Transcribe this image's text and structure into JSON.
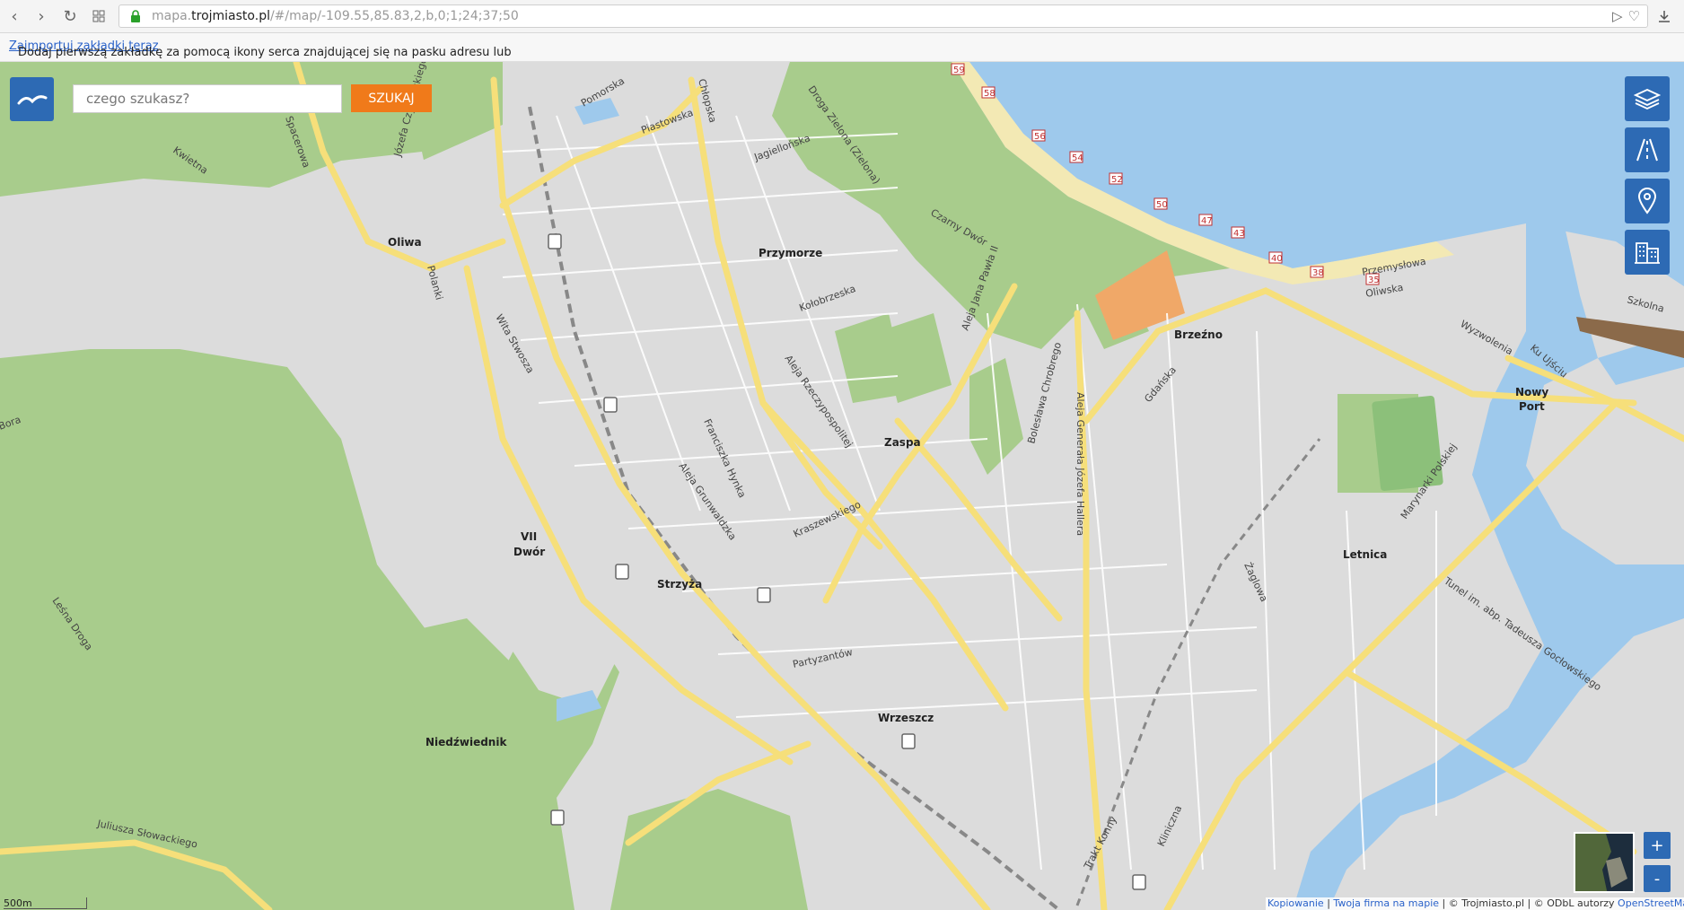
{
  "browser": {
    "url_prefix": "mapa.",
    "url_domain": "trojmiasto.pl",
    "url_path": "/#/map/-109.55,85.83,2,b,0;1;24;37;50"
  },
  "bookmarks_bar": {
    "message": "Dodaj pierwszą zakładkę za pomocą ikony serca znajdującej się na pasku adresu lub",
    "link": "Zaimportuj zakładki teraz"
  },
  "search": {
    "placeholder": "czego szukasz?",
    "button_label": "SZUKAJ"
  },
  "controls": {
    "zoom_in": "+",
    "zoom_out": "-",
    "scale": "500m"
  },
  "attribution": {
    "copy": "Kopiowanie",
    "sep1": "|",
    "firm": "Twoja firma na mapie",
    "sep2": "|",
    "owner": "© Trojmiasto.pl | © ODbL autorzy",
    "osm": "OpenStreetMap"
  },
  "map": {
    "districts": [
      {
        "name": "Oliwa"
      },
      {
        "name": "Przymorze"
      },
      {
        "name": "Brzeźno"
      },
      {
        "name": "Nowy"
      },
      {
        "name": "Port"
      },
      {
        "name": "Zaspa"
      },
      {
        "name": "VII"
      },
      {
        "name": "Dwór"
      },
      {
        "name": "Strzyża"
      },
      {
        "name": "Letnica"
      },
      {
        "name": "Wrzeszcz"
      },
      {
        "name": "Niedźwiednik"
      }
    ],
    "streets": [
      {
        "name": "Pomorska"
      },
      {
        "name": "Chłopska"
      },
      {
        "name": "Piastowska"
      },
      {
        "name": "Jagiellońska"
      },
      {
        "name": "Droga Zielona (Zielona)"
      },
      {
        "name": "Czarny Dwór"
      },
      {
        "name": "Kołobrzeska"
      },
      {
        "name": "Aleja Jana Pawła II"
      },
      {
        "name": "Aleja Rzeczypospolitej"
      },
      {
        "name": "Gdańska"
      },
      {
        "name": "Przemysłowa"
      },
      {
        "name": "Oliwska"
      },
      {
        "name": "Szkolna"
      },
      {
        "name": "Wyzwolenia"
      },
      {
        "name": "Ku Ujściu"
      },
      {
        "name": "Aleja Generała Józefa Hallera"
      },
      {
        "name": "Bolesława Chrobrego"
      },
      {
        "name": "Wita Stwosza"
      },
      {
        "name": "Polanki"
      },
      {
        "name": "Aleja Grunwaldzka"
      },
      {
        "name": "Franciszka Hynka"
      },
      {
        "name": "Marynarki Polskiej"
      },
      {
        "name": "Tunel im. abp. Tadeusza Gocłowskiego"
      },
      {
        "name": "Żaglowa"
      },
      {
        "name": "Partyzantów"
      },
      {
        "name": "Juliusza Słowackiego"
      },
      {
        "name": "Kliniczna"
      },
      {
        "name": "Spacerowa"
      },
      {
        "name": "Kwietna"
      },
      {
        "name": "Józefa Czyżewskiego"
      },
      {
        "name": "Kraszewskiego"
      },
      {
        "name": "Trakt Konny"
      },
      {
        "name": "Leśna Droga"
      },
      {
        "name": "Bora"
      },
      {
        "name": "Chrobrego"
      }
    ],
    "beach_markers": [
      "59",
      "58",
      "56",
      "54",
      "52",
      "50",
      "47",
      "43",
      "40",
      "38",
      "35"
    ]
  },
  "colors": {
    "accent": "#2d6ab4",
    "search_button": "#f07a1a",
    "sea": "#9ec9ec",
    "forest": "#a8cc8c",
    "road": "#f6df7a",
    "land": "#dcdcdc"
  }
}
